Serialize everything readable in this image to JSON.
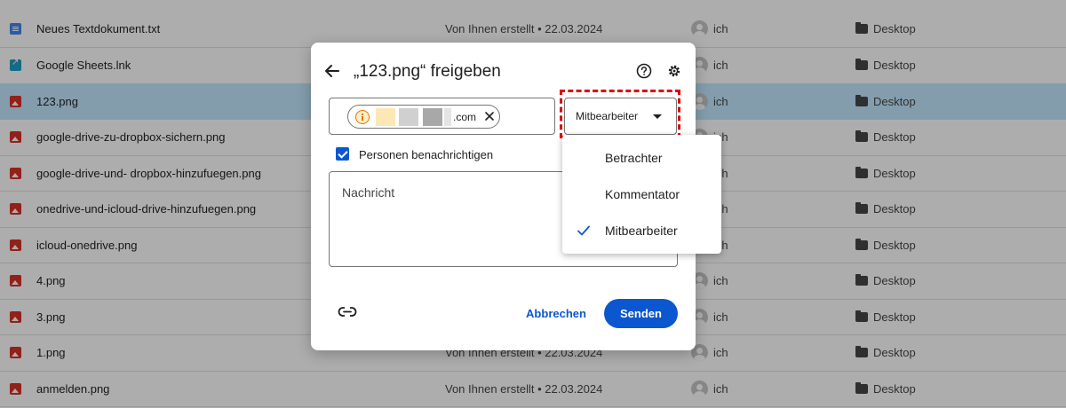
{
  "files": [
    {
      "name": "Neues Textdokument.txt",
      "icon": "doc",
      "created": "Von Ihnen erstellt • 22.03.2024",
      "owner": "ich",
      "location": "Desktop",
      "selected": false
    },
    {
      "name": "Google Sheets.lnk",
      "icon": "lnk",
      "created": "",
      "owner": "ich",
      "location": "Desktop",
      "selected": false
    },
    {
      "name": "123.png",
      "icon": "img",
      "created": "",
      "owner": "ich",
      "location": "Desktop",
      "selected": true
    },
    {
      "name": "google-drive-zu-dropbox-sichern.png",
      "icon": "img",
      "created": "",
      "owner": "ich",
      "location": "Desktop",
      "selected": false
    },
    {
      "name": "google-drive-und- dropbox-hinzufuegen.png",
      "icon": "img",
      "created": "",
      "owner": "ich",
      "location": "Desktop",
      "selected": false
    },
    {
      "name": "onedrive-und-icloud-drive-hinzufuegen.png",
      "icon": "img",
      "created": "",
      "owner": "ich",
      "location": "Desktop",
      "selected": false
    },
    {
      "name": "icloud-onedrive.png",
      "icon": "img",
      "created": "",
      "owner": "ich",
      "location": "Desktop",
      "selected": false
    },
    {
      "name": "4.png",
      "icon": "img",
      "created": "",
      "owner": "ich",
      "location": "Desktop",
      "selected": false
    },
    {
      "name": "3.png",
      "icon": "img",
      "created": "",
      "owner": "ich",
      "location": "Desktop",
      "selected": false
    },
    {
      "name": "1.png",
      "icon": "img",
      "created": "Von Ihnen erstellt • 22.03.2024",
      "owner": "ich",
      "location": "Desktop",
      "selected": false
    },
    {
      "name": "anmelden.png",
      "icon": "img",
      "created": "Von Ihnen erstellt • 22.03.2024",
      "owner": "ich",
      "location": "Desktop",
      "selected": false
    }
  ],
  "dialog": {
    "title": "„123.png“ freigeben",
    "recipient_chip_text": ".com",
    "permission_selected": "Mitbearbeiter",
    "notify_label": "Personen benachrichtigen",
    "notify_checked": true,
    "message_placeholder": "Nachricht",
    "cancel_label": "Abbrechen",
    "send_label": "Senden"
  },
  "permission_menu": {
    "items": [
      {
        "label": "Betrachter",
        "checked": false
      },
      {
        "label": "Kommentator",
        "checked": false
      },
      {
        "label": "Mitbearbeiter",
        "checked": true
      }
    ]
  },
  "colors": {
    "accent": "#0b57d0",
    "selected_row": "#c2e7ff",
    "highlight": "#e00000",
    "image_icon": "#d93025"
  }
}
